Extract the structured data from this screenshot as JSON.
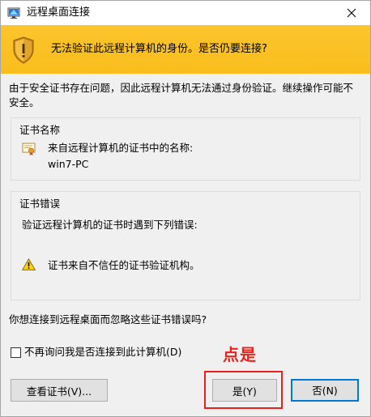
{
  "window": {
    "title": "远程桌面连接",
    "close_glyph": "✕"
  },
  "banner": {
    "text": "无法验证此远程计算机的身份。是否仍要连接?",
    "icon": "shield-warning-icon",
    "color": "#fcc429"
  },
  "description": "由于安全证书存在问题，因此远程计算机无法通过身份验证。继续操作可能不安全。",
  "cert_name_group": {
    "title": "证书名称",
    "source_label": "来自远程计算机的证书中的名称:",
    "host": "win7-PC"
  },
  "cert_error_group": {
    "title": "证书错误",
    "intro": "验证远程计算机的证书时遇到下列错误:",
    "errors": [
      "证书来自不信任的证书验证机构。"
    ]
  },
  "question": "你想连接到远程桌面而忽略这些证书错误吗?",
  "checkbox": {
    "label": "不再询问我是否连接到此计算机(D)",
    "checked": false
  },
  "annotation": {
    "text": "点是",
    "color": "#e8231e"
  },
  "buttons": {
    "view_cert": "查看证书(V)...",
    "yes": "是(Y)",
    "no": "否(N)"
  },
  "colors": {
    "focus_border": "#0078d7",
    "highlight": "#e8231e"
  }
}
